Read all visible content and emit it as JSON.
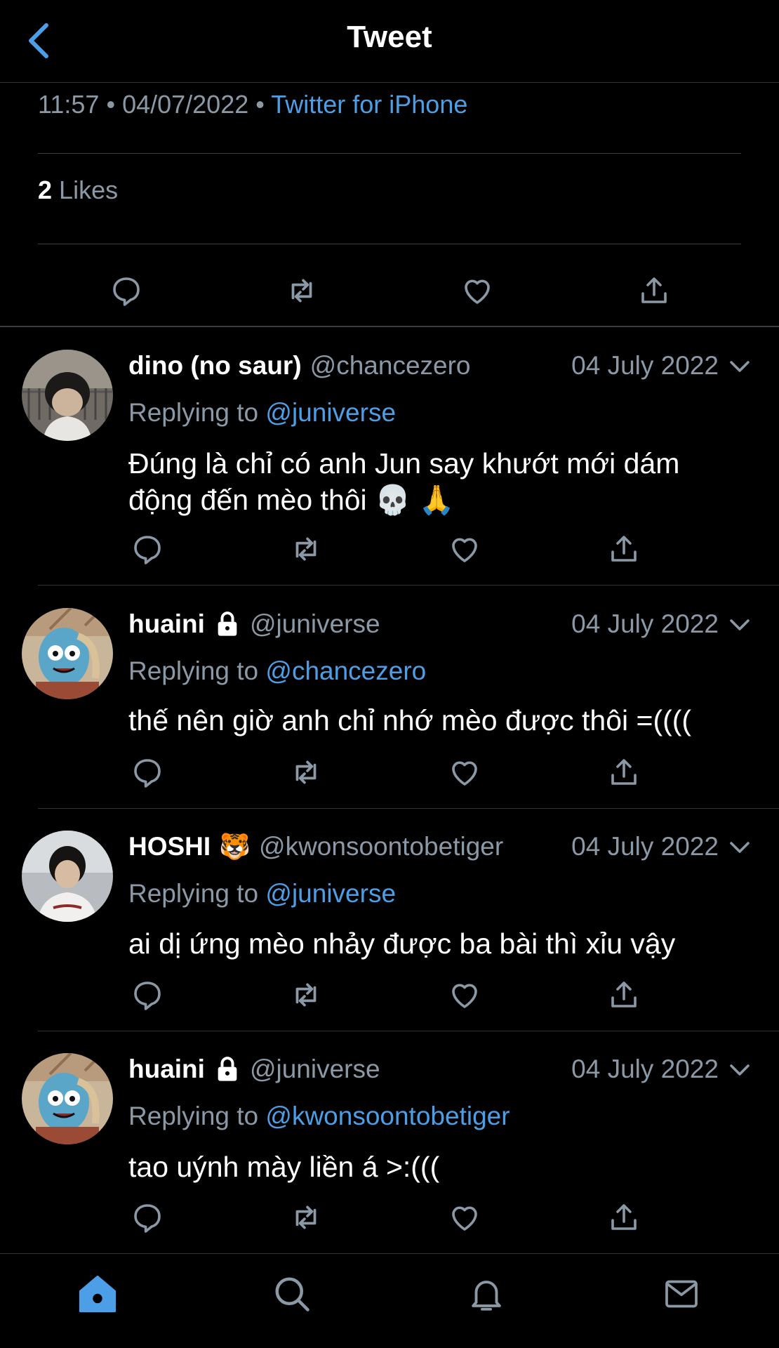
{
  "nav": {
    "title": "Tweet",
    "back_icon": "chevron-left-icon"
  },
  "tweet_meta": {
    "time": "11:57",
    "date": "04/07/2022",
    "separator": "•",
    "source": "Twitter for iPhone"
  },
  "stats": {
    "likes_count": "2",
    "likes_label": "Likes"
  },
  "colors": {
    "accent": "#4c9ee6",
    "secondary_text": "#8b98a5",
    "background": "#000000",
    "divider": "#2f3336"
  },
  "replies": [
    {
      "name": "dino (no saur)",
      "handle": "@chancezero",
      "badge": "",
      "date": "04 July 2022",
      "replying_prefix": "Replying to",
      "replying_to": "@juniverse",
      "text": "Đúng là chỉ có anh Jun say khướt mới dám động đến mèo thôi 💀 🙏"
    },
    {
      "name": "huaini",
      "handle": "@juniverse",
      "badge": "lock-icon",
      "date": "04 July 2022",
      "replying_prefix": "Replying to",
      "replying_to": "@chancezero",
      "text": "thế nên giờ anh chỉ nhớ mèo được thôi =(((("
    },
    {
      "name": "HOSHI",
      "handle": "@kwonsoontobetiger",
      "badge": "🐯",
      "date": "04 July 2022",
      "replying_prefix": "Replying to",
      "replying_to": "@juniverse",
      "text": "ai dị ứng mèo nhảy được ba bài thì xỉu vậy"
    },
    {
      "name": "huaini",
      "handle": "@juniverse",
      "badge": "lock-icon",
      "date": "04 July 2022",
      "replying_prefix": "Replying to",
      "replying_to": "@kwonsoontobetiger",
      "text": "tao uýnh mày liền á >:((("
    }
  ],
  "tab_bar": {
    "active_tab": "home",
    "tabs": [
      "home-icon",
      "search-icon",
      "notifications-bell-icon",
      "messages-mail-icon"
    ]
  }
}
